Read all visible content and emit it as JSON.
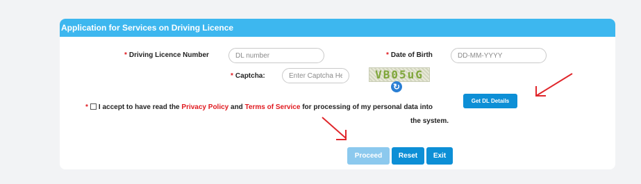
{
  "form": {
    "title": "Application for Services on Driving Licence",
    "required_mark": "*",
    "dl_number": {
      "label": "Driving Licence Number",
      "placeholder": "DL number",
      "value": ""
    },
    "dob": {
      "label": "Date of Birth",
      "placeholder": "DD-MM-YYYY",
      "value": ""
    },
    "captcha": {
      "label": "Captcha:",
      "placeholder": "Enter Captcha Here",
      "value": "",
      "image_text": "VB05uG",
      "refresh_icon": "refresh-icon"
    },
    "get_dl_label": "Get DL Details",
    "consent": {
      "prefix": "I accept to have read the",
      "privacy_link": "Privacy Policy",
      "and_text": "and",
      "terms_link": "Terms of Service",
      "suffix": "for processing of my personal data into",
      "line2": "the system."
    },
    "buttons": {
      "proceed": "Proceed",
      "reset": "Reset",
      "exit": "Exit"
    }
  },
  "colors": {
    "header": "#3db7ef",
    "primary_button": "#0d8fd6",
    "disabled_button": "#8cc9ee",
    "required": "#e0191f",
    "annotation_arrow": "#e0262b"
  }
}
